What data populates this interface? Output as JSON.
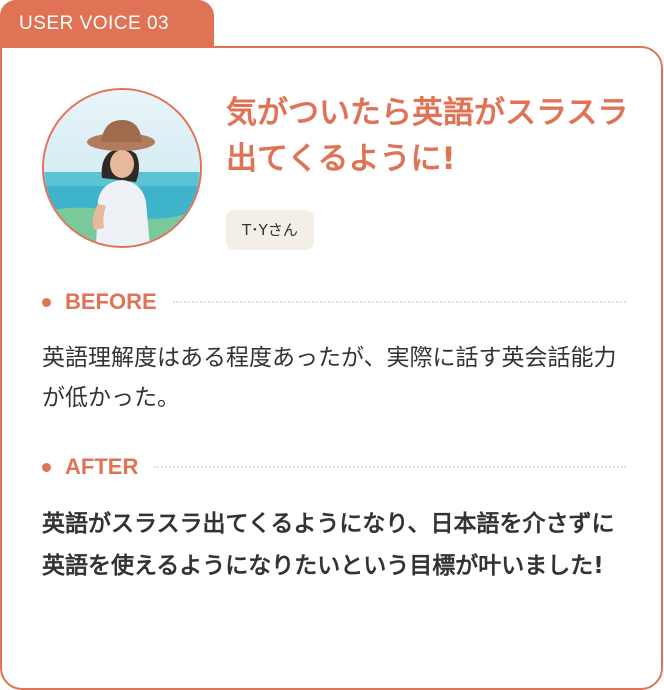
{
  "tab_label": "USER VOICE 03",
  "headline": "気がついたら英語がスラスラ出てくるように!",
  "user_name": "T･Yさん",
  "before": {
    "label": "BEFORE",
    "text": "英語理解度はある程度あったが、実際に話す英会話能力が低かった。"
  },
  "after": {
    "label": "AFTER",
    "text": "英語がスラスラ出てくるようになり、日本語を介さずに英語を使えるようになりたいという目標が叶いました!"
  },
  "colors": {
    "accent": "#e07356",
    "name_tag_bg": "#f3eee6",
    "body_text": "#333333",
    "dotted_rule": "#e3ddd3"
  }
}
